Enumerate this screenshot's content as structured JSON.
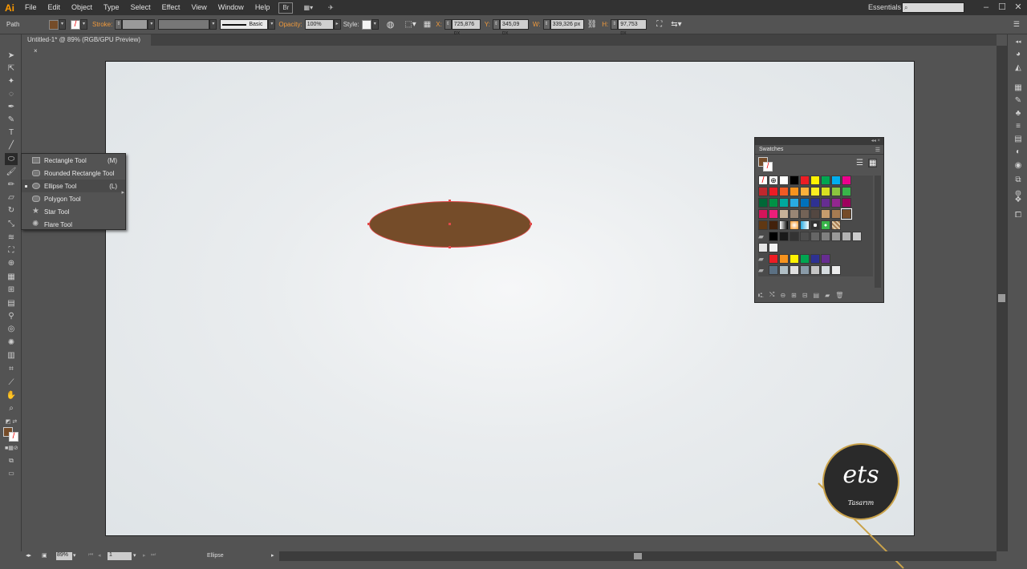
{
  "app": {
    "logo": "Ai"
  },
  "menu": [
    "File",
    "Edit",
    "Object",
    "Type",
    "Select",
    "Effect",
    "View",
    "Window",
    "Help"
  ],
  "menubar_icons": {
    "bridge": "Br",
    "arrange": "▦▾",
    "sync": "✈"
  },
  "workspace": "Essentials",
  "control_bar": {
    "selection_type": "Path",
    "stroke_label": "Stroke:",
    "stroke_profile": "Basic",
    "opacity_label": "Opacity:",
    "opacity_value": "100%",
    "style_label": "Style:",
    "x_label": "X:",
    "x_value": "725,876 px",
    "y_label": "Y:",
    "y_value": "345,09 px",
    "w_label": "W:",
    "w_value": "339,326 px",
    "h_label": "H:",
    "h_value": "97,753 px",
    "fill_color": "#754c29"
  },
  "document": {
    "tab_title": "Untitled-1* @ 89% (RGB/GPU Preview)",
    "close": "×"
  },
  "tool_flyout": {
    "items": [
      {
        "label": "Rectangle Tool",
        "key": "(M)",
        "icon": "rectangle-icon"
      },
      {
        "label": "Rounded Rectangle Tool",
        "key": "",
        "icon": "rounded-rectangle-icon"
      },
      {
        "label": "Ellipse Tool",
        "key": "(L)",
        "icon": "ellipse-icon"
      },
      {
        "label": "Polygon Tool",
        "key": "",
        "icon": "polygon-icon"
      },
      {
        "label": "Star Tool",
        "key": "",
        "icon": "star-icon"
      },
      {
        "label": "Flare Tool",
        "key": "",
        "icon": "flare-icon"
      }
    ]
  },
  "swatches_panel": {
    "title": "Swatches",
    "controls": "◂◂ ×",
    "rows": [
      [
        "none",
        "registration",
        "#ffffff",
        "#000000",
        "#ed1c24",
        "#fff200",
        "#00a651",
        "#00aeef",
        "#ec008c"
      ],
      [
        "#c1272d",
        "#ed1c24",
        "#f15a24",
        "#f7931e",
        "#fbb03b",
        "#fcee21",
        "#d9e021",
        "#8cc63f",
        "#39b54a"
      ],
      [
        "#006837",
        "#009245",
        "#00a99d",
        "#29abe2",
        "#0071bc",
        "#2e3192",
        "#662d91",
        "#93278f",
        "#9e005d"
      ],
      [
        "#d4145a",
        "#ed1e79",
        "#c7b299",
        "#998675",
        "#736357",
        "#534741",
        "#c69c6d",
        "#a67c52",
        "#754c29"
      ],
      [
        "#603813",
        "#42210b",
        "gradient1",
        "gradient2",
        "gradient3",
        "pattern1",
        "pattern2",
        "pattern3"
      ],
      [
        "folder",
        "#000000",
        "#1a1a1a",
        "#333333",
        "#4d4d4d",
        "#666666",
        "#808080",
        "#999999",
        "#b3b3b3",
        "#cccccc"
      ],
      [
        "#e6e6e6",
        "#f2f2f2"
      ],
      [
        "folder",
        "#ed1c24",
        "#f7931e",
        "#fff200",
        "#00a651",
        "#2e3192",
        "#662d91"
      ],
      [
        "folder",
        "#5b7083",
        "#b0bec5",
        "#e0e0e0",
        "#8a9ba8",
        "#c5c5c5",
        "#d5dbdf",
        "#ececec"
      ]
    ]
  },
  "status": {
    "zoom": "89%",
    "page": "1",
    "tool": "Ellipse"
  },
  "artwork": {
    "ellipse_fill": "#754c29",
    "ellipse_stroke": "#e04a4a"
  },
  "watermark": {
    "main": "ets",
    "sub": "Tasarım"
  }
}
